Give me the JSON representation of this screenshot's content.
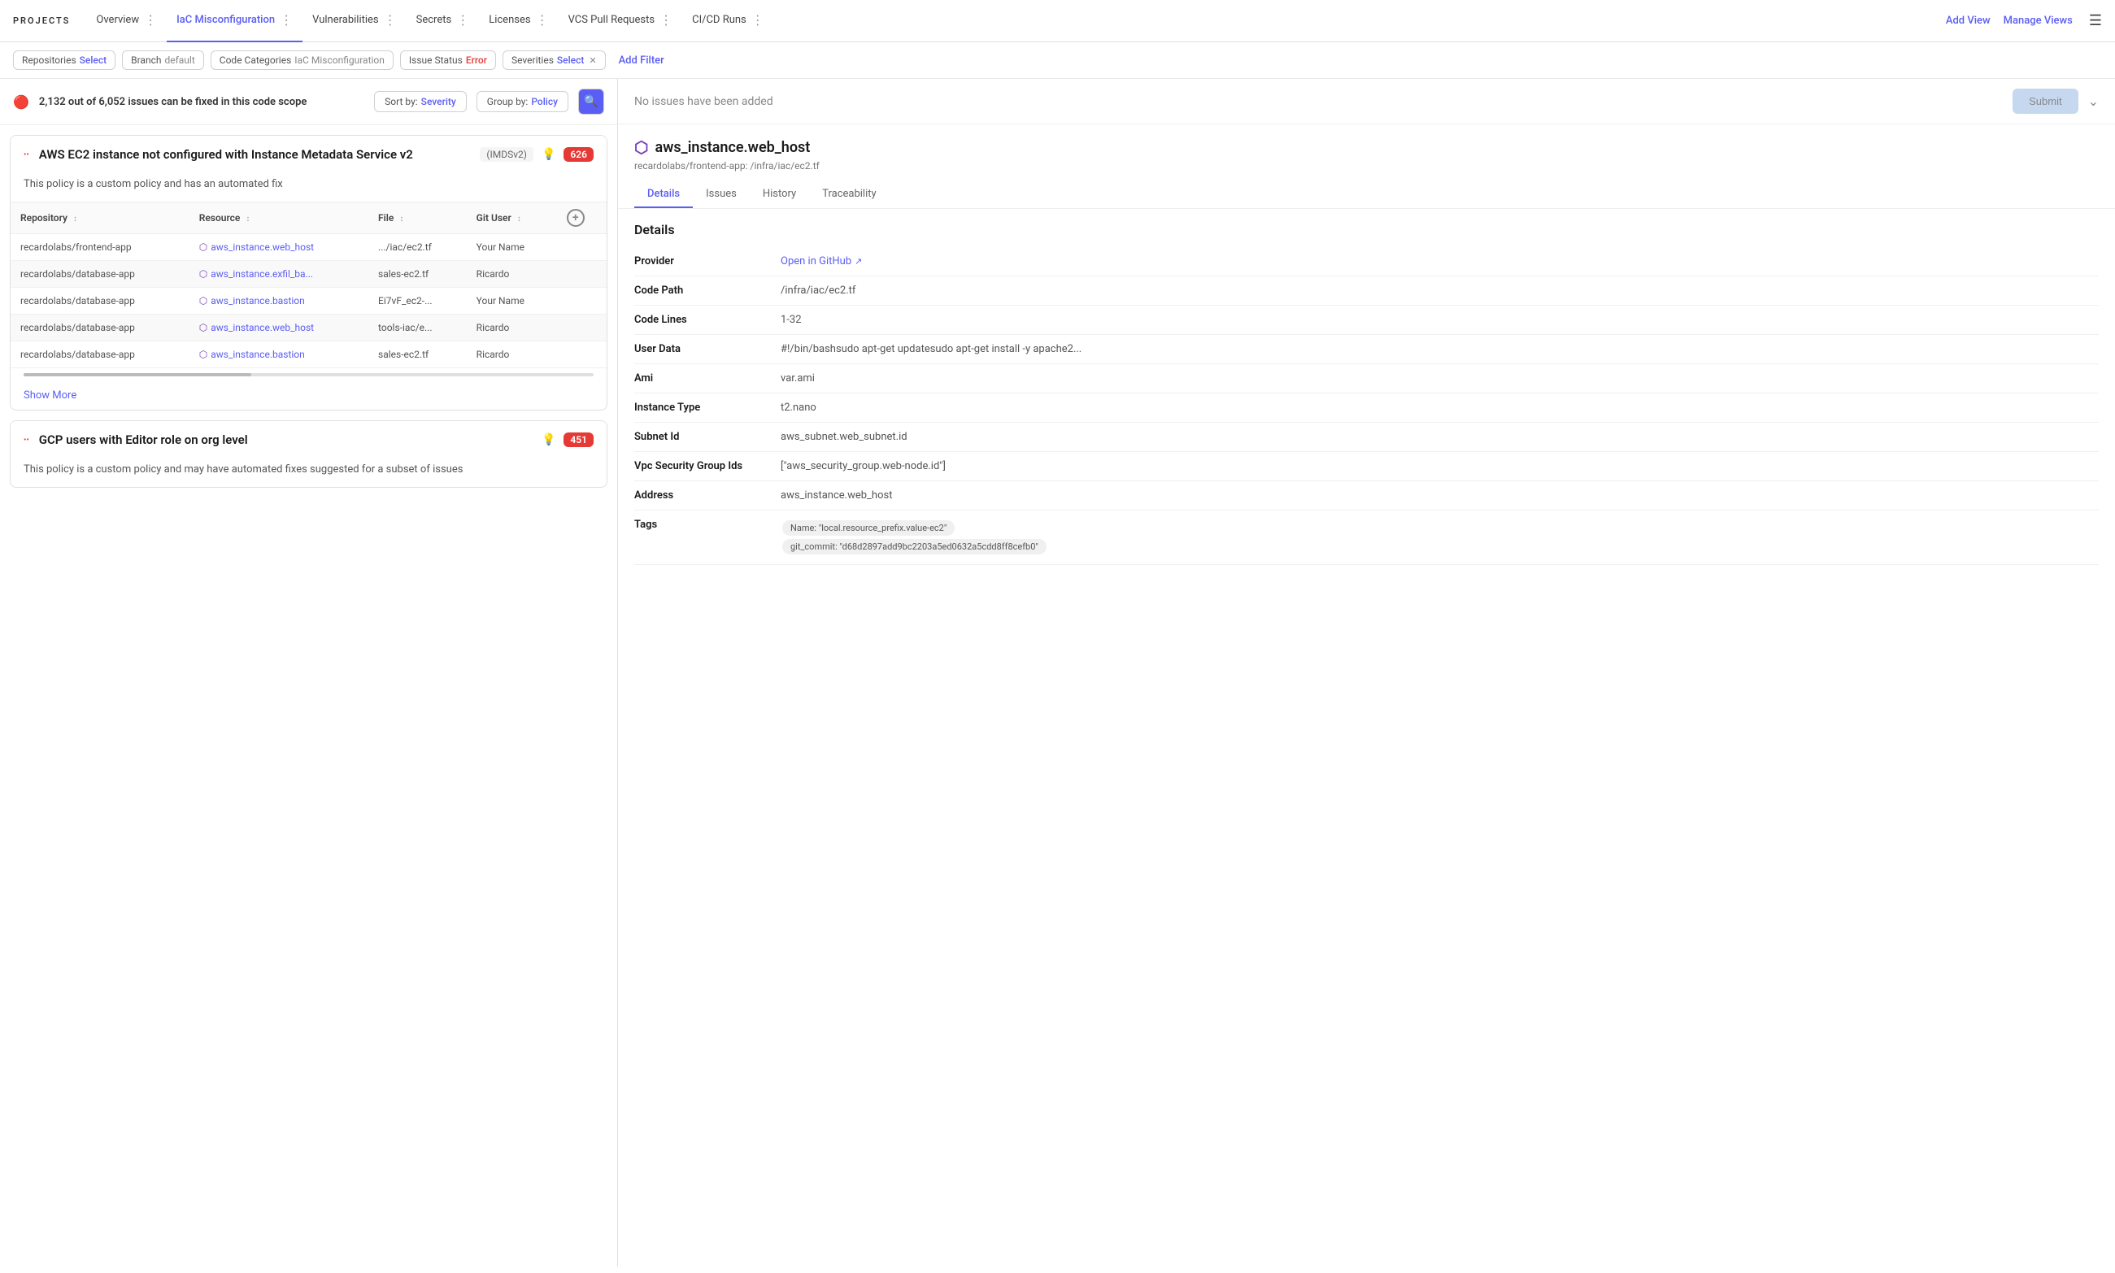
{
  "nav": {
    "brand": "PROJECTS",
    "items": [
      {
        "id": "overview",
        "label": "Overview",
        "active": false
      },
      {
        "id": "iac",
        "label": "IaC Misconfiguration",
        "active": true
      },
      {
        "id": "vulnerabilities",
        "label": "Vulnerabilities",
        "active": false
      },
      {
        "id": "secrets",
        "label": "Secrets",
        "active": false
      },
      {
        "id": "licenses",
        "label": "Licenses",
        "active": false
      },
      {
        "id": "vcs",
        "label": "VCS Pull Requests",
        "active": false
      },
      {
        "id": "cicd",
        "label": "CI/CD Runs",
        "active": false
      }
    ],
    "add_view": "Add View",
    "manage_views": "Manage Views"
  },
  "filters": {
    "repositories": {
      "label": "Repositories",
      "value": "Select"
    },
    "branch": {
      "label": "Branch",
      "value": "default"
    },
    "code_categories": {
      "label": "Code Categories",
      "value": "IaC Misconfiguration"
    },
    "issue_status": {
      "label": "Issue Status",
      "value": "Error"
    },
    "severities": {
      "label": "Severities",
      "value": "Select"
    },
    "add_filter": "Add Filter"
  },
  "summary": {
    "text": "2,132 out of 6,052 issues can be fixed in this code scope",
    "sort_label": "Sort by:",
    "sort_value": "Severity",
    "group_label": "Group by:",
    "group_value": "Policy"
  },
  "issues": [
    {
      "id": "issue-1",
      "dots": "...",
      "title": "AWS EC2 instance not configured with Instance Metadata Service v2",
      "tag": "(IMDSv2)",
      "badge": "626",
      "description": "This policy is a custom policy and has an automated fix",
      "columns": [
        "Repository",
        "Resource",
        "File",
        "Git User"
      ],
      "rows": [
        {
          "repo": "recardolabs/frontend-app",
          "resource": "aws_instance.web_host",
          "file": ".../iac/ec2.tf",
          "git_user": "Your Name"
        },
        {
          "repo": "recardolabs/database-app",
          "resource": "aws_instance.exfil_ba...",
          "file": "sales-ec2.tf",
          "git_user": "Ricardo"
        },
        {
          "repo": "recardolabs/database-app",
          "resource": "aws_instance.bastion",
          "file": "Ei7vF_ec2-...",
          "git_user": "Your Name"
        },
        {
          "repo": "recardolabs/database-app",
          "resource": "aws_instance.web_host",
          "file": "tools-iac/e...",
          "git_user": "Ricardo"
        },
        {
          "repo": "recardolabs/database-app",
          "resource": "aws_instance.bastion",
          "file": "sales-ec2.tf",
          "git_user": "Ricardo"
        }
      ],
      "show_more": "Show More"
    },
    {
      "id": "issue-2",
      "dots": "...",
      "title": "GCP users with Editor role on org level",
      "tag": "",
      "badge": "451",
      "description": "This policy is a custom policy and may have automated fixes suggested for a subset of issues",
      "columns": [],
      "rows": [],
      "show_more": ""
    }
  ],
  "right_panel": {
    "submit_text": "No issues have been added",
    "submit_btn": "Submit",
    "resource_name": "aws_instance.web_host",
    "resource_path": "recardolabs/frontend-app: /infra/iac/ec2.tf",
    "tabs": [
      "Details",
      "Issues",
      "History",
      "Traceability"
    ],
    "active_tab": "Details",
    "details_title": "Details",
    "details": [
      {
        "key": "Provider",
        "value": "Open in GitHub",
        "type": "link"
      },
      {
        "key": "Code Path",
        "value": "/infra/iac/ec2.tf",
        "type": "text"
      },
      {
        "key": "Code Lines",
        "value": "1-32",
        "type": "text"
      },
      {
        "key": "User Data",
        "value": "#!/bin/bashsudo apt-get updatesudo apt-get install -y apache2...",
        "type": "text"
      },
      {
        "key": "Ami",
        "value": "var.ami",
        "type": "text"
      },
      {
        "key": "Instance Type",
        "value": "t2.nano",
        "type": "text"
      },
      {
        "key": "Subnet Id",
        "value": "aws_subnet.web_subnet.id",
        "type": "text"
      },
      {
        "key": "Vpc Security Group Ids",
        "value": "[\"aws_security_group.web-node.id\"]",
        "type": "text"
      },
      {
        "key": "Address",
        "value": "aws_instance.web_host",
        "type": "text"
      },
      {
        "key": "Tags",
        "value": "",
        "type": "tags",
        "tags": [
          "Name: \"local.resource_prefix.value-ec2\"",
          "git_commit: \"d68d2897add9bc2203a5ed0632a5cdd8ff8cefb0\""
        ]
      }
    ]
  }
}
